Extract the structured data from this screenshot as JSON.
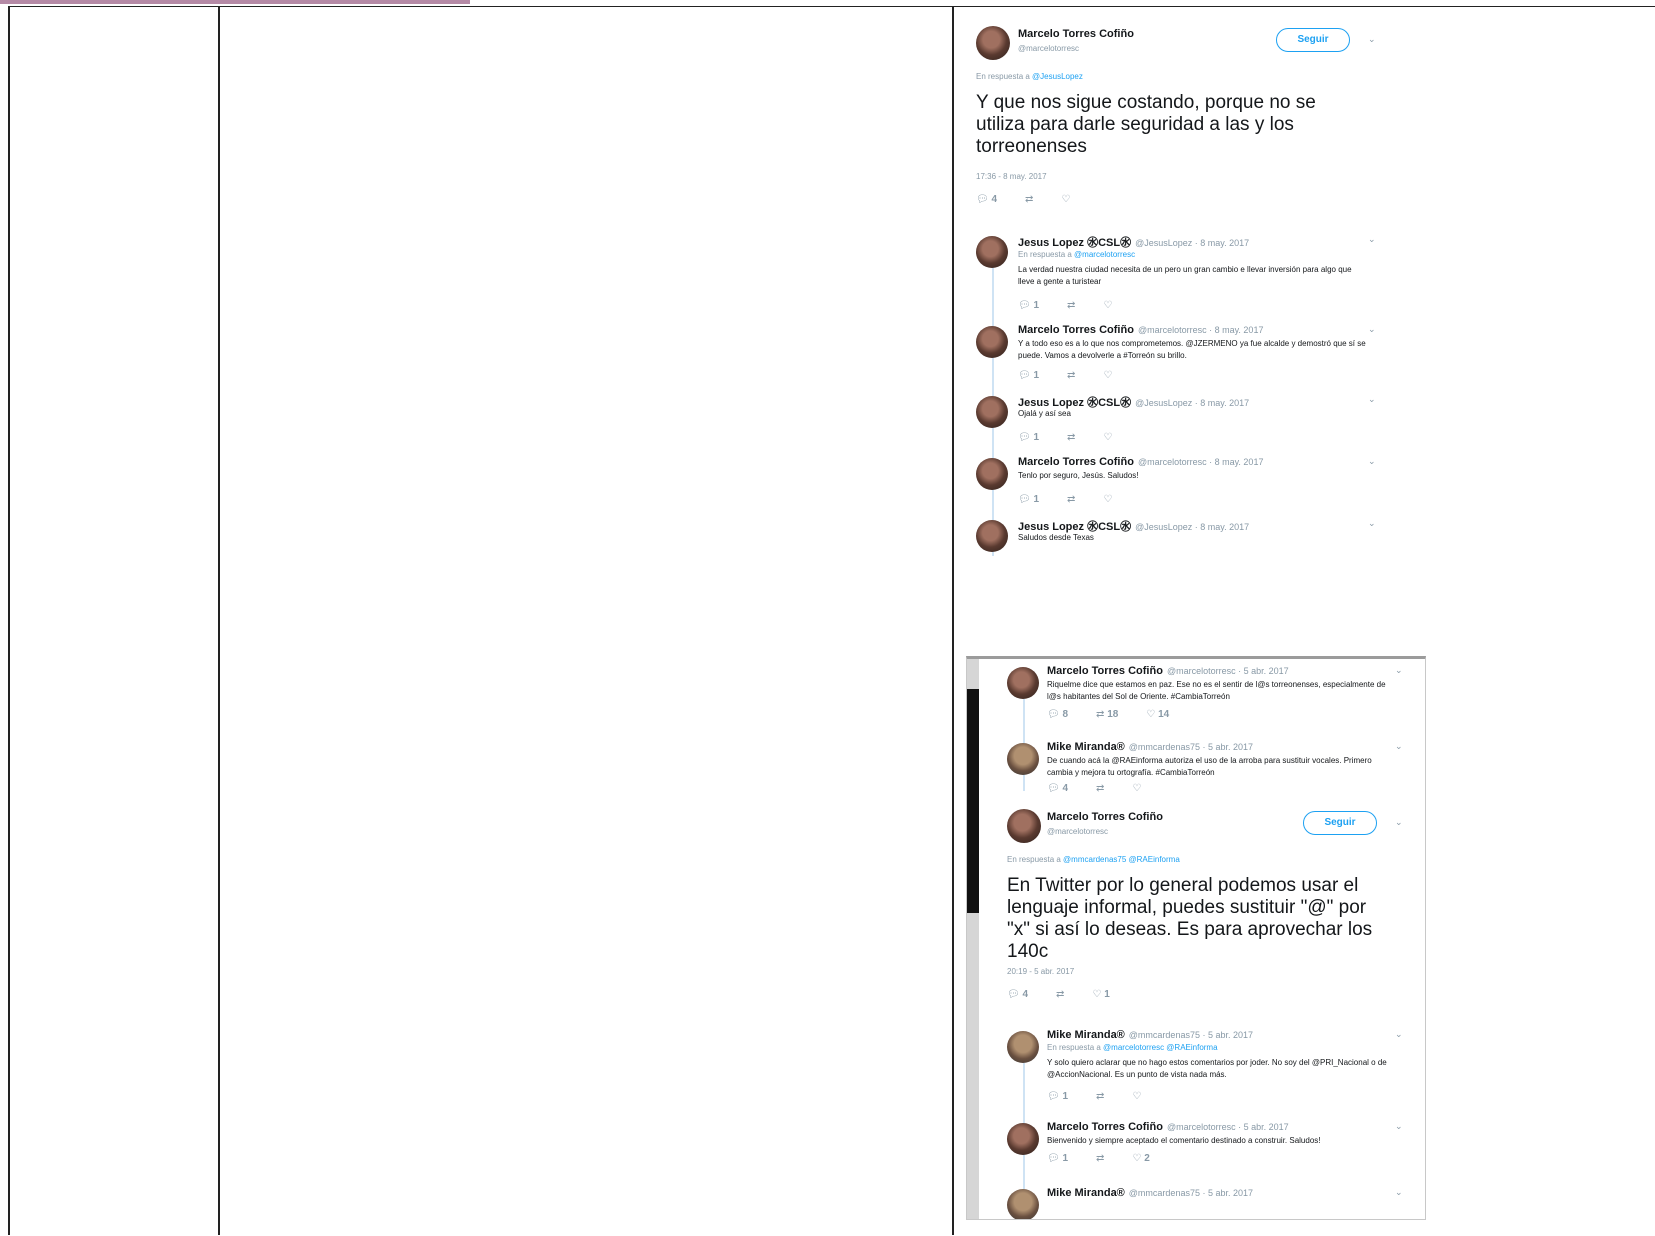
{
  "screenshot1": {
    "main_tweet": {
      "author": "Marcelo Torres Cofiño",
      "handle": "@marcelotorresc",
      "follow_label": "Seguir",
      "in_reply_to": "En respuesta a",
      "reply_target": "@JesusLopez",
      "text": "Y que nos sigue costando, porque no se utiliza para darle seguridad a las y los torreonenses",
      "timestamp": "17:36 - 8 may. 2017",
      "reply_count": "4"
    },
    "replies": [
      {
        "author": "Jesus Lopez ㊌CSL㊌",
        "meta": "@JesusLopez · 8 may. 2017",
        "reply_to": "En respuesta a",
        "reply_target": "@marcelotorresc",
        "text": "La verdad nuestra ciudad necesita de un pero un gran cambio e llevar inversión para algo que lleve a gente a turistear",
        "c1": "1",
        "c2": "",
        "c3": ""
      },
      {
        "author": "Marcelo Torres Cofiño",
        "meta": "@marcelotorresc · 8 may. 2017",
        "text": "Y a todo eso es a lo que nos comprometemos. @JZERMENO ya fue alcalde y demostró que sí se puede. Vamos a devolverle a #Torreón su brillo.",
        "c1": "1",
        "c2": "",
        "c3": ""
      },
      {
        "author": "Jesus Lopez ㊌CSL㊌",
        "meta": "@JesusLopez · 8 may. 2017",
        "text": "Ojalá y así sea",
        "c1": "1",
        "c2": "",
        "c3": ""
      },
      {
        "author": "Marcelo Torres Cofiño",
        "meta": "@marcelotorresc · 8 may. 2017",
        "text": "Tenlo por seguro, Jesús. Saludos!",
        "c1": "1",
        "c2": "",
        "c3": ""
      },
      {
        "author": "Jesus Lopez ㊌CSL㊌",
        "meta": "@JesusLopez · 8 may. 2017",
        "text": "Saludos desde Texas"
      }
    ]
  },
  "screenshot2": {
    "top_replies": [
      {
        "author": "Marcelo Torres Cofiño",
        "meta": "@marcelotorresc · 5 abr. 2017",
        "text": "Riquelme dice que estamos en paz. Ese no es el sentir de l@s torreonenses, especialmente de l@s habitantes del Sol de Oriente. #CambiaTorreón",
        "c1": "8",
        "c2": "18",
        "c3": "14"
      },
      {
        "author": "Mike Miranda®",
        "meta": "@mmcardenas75 · 5 abr. 2017",
        "text": "De cuando acá la @RAEinforma autoriza el uso de la arroba para sustituir vocales. Primero cambia y mejora tu ortografía. #CambiaTorreón",
        "c1": "4",
        "c2": "",
        "c3": ""
      }
    ],
    "main_tweet": {
      "author": "Marcelo Torres Cofiño",
      "handle": "@marcelotorresc",
      "follow_label": "Seguir",
      "in_reply_to": "En respuesta a",
      "reply_target": "@mmcardenas75 @RAEinforma",
      "text": "En Twitter por lo general podemos usar el lenguaje informal, puedes sustituir \"@\" por \"x\" si así lo deseas. Es para aprovechar los 140c",
      "timestamp": "20:19 - 5 abr. 2017",
      "reply_count": "4",
      "like_count": "1"
    },
    "replies": [
      {
        "author": "Mike Miranda®",
        "meta": "@mmcardenas75 · 5 abr. 2017",
        "reply_to": "En respuesta a",
        "reply_target": "@marcelotorresc @RAEinforma",
        "text": "Y solo quiero aclarar que no hago estos comentarios por joder. No soy del @PRI_Nacional o de @AccionNacional. Es un punto de vista nada más.",
        "c1": "1",
        "c2": "",
        "c3": ""
      },
      {
        "author": "Marcelo Torres Cofiño",
        "meta": "@marcelotorresc · 5 abr. 2017",
        "text": "Bienvenido y siempre aceptado el comentario destinado a construir. Saludos!",
        "c1": "1",
        "c2": "",
        "c3": "2"
      },
      {
        "author": "Mike Miranda®",
        "meta": "@mmcardenas75 · 5 abr. 2017"
      }
    ]
  },
  "icons": {
    "reply": "reply-icon",
    "retweet": "retweet-icon",
    "like": "like-icon",
    "chevron": "chevron-down-icon"
  }
}
